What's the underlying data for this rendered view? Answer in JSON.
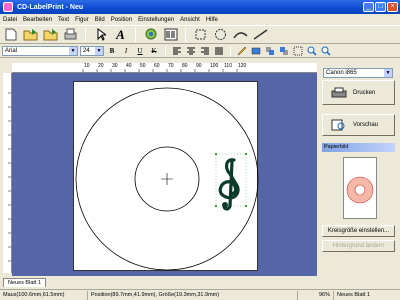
{
  "window": {
    "title": "CD-LabelPrint - Neu"
  },
  "menu": [
    "Datei",
    "Bearbeiten",
    "Text",
    "Figur",
    "Bild",
    "Position",
    "Einstellungen",
    "Ansicht",
    "Hilfe"
  ],
  "toolbar2": {
    "font": "Arial",
    "size": "24"
  },
  "ruler": {
    "ticks": [
      "10",
      "20",
      "30",
      "40",
      "50",
      "60",
      "70",
      "80",
      "90",
      "100",
      "110",
      "120"
    ]
  },
  "right_panel": {
    "printer": "Canon i865",
    "print_label": "Drucken",
    "preview_label": "Vorschau",
    "paper_label": "Papierbild",
    "circle_button": "Kreisgröße einstellen...",
    "disabled_button": "Hintergrund ändern"
  },
  "tabs": [
    "Neues Blatt 1"
  ],
  "status": {
    "mouse": "Maus(100.6mm,61.5mm)",
    "position": "Position(89.7mm,41.9mm), Größe(19.3mm,31.9mm)",
    "zoom": "96%",
    "sheet": "Neues Blatt 1"
  },
  "colors": {
    "title_bar": "#0a4bd0",
    "canvas_bg": "#5566a8",
    "disc_preview": "#f4b8a8"
  }
}
